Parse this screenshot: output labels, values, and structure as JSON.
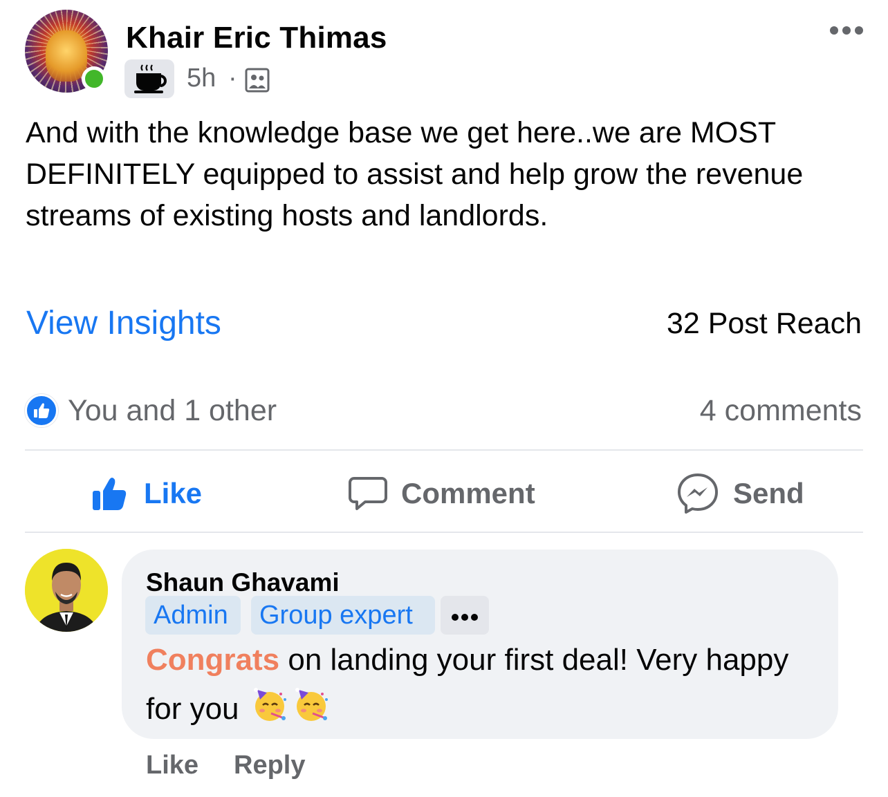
{
  "post": {
    "author": "Khair Eric Thimas",
    "time": "5h",
    "separator": "·",
    "text": "And with the knowledge base we get here..we are MOST DEFINITELY equipped to assist and help grow the revenue streams of existing hosts and landlords.",
    "badge_icon": "coffee-cup-icon",
    "audience_icon": "group-icon",
    "online": true
  },
  "insights": {
    "link_label": "View Insights",
    "reach": "32 Post Reach"
  },
  "reactions": {
    "summary": "You and 1 other",
    "comments": "4 comments"
  },
  "actions": {
    "like": "Like",
    "comment": "Comment",
    "send": "Send"
  },
  "comment": {
    "author": "Shaun Ghavami",
    "badges": [
      "Admin",
      "Group expert"
    ],
    "highlight": "Congrats",
    "text_rest": " on landing your first deal! Very happy for you",
    "emojis": [
      "partying-face-icon",
      "partying-face-icon"
    ],
    "like_label": "Like",
    "reply_label": "Reply"
  },
  "colors": {
    "accent": "#1877f2",
    "secondary_text": "#65676b",
    "online": "#42b72a",
    "highlight": "#f0805e",
    "bubble": "#f0f2f5"
  }
}
